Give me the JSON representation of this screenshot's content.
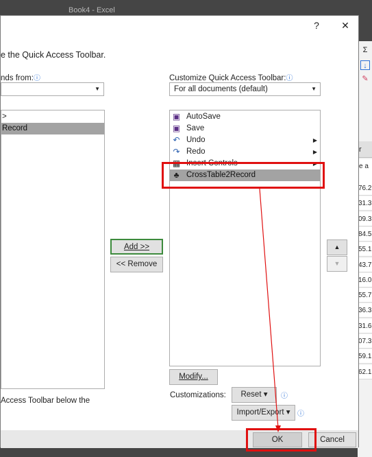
{
  "excel": {
    "window_title": "Book4 - Excel",
    "ribbon_icons": [
      "Σ",
      "↓",
      "✎"
    ],
    "column_header": "r",
    "header_cell": "e a",
    "cells": [
      "76.2",
      "31.3",
      "09.3",
      "84.5",
      "55.1",
      "43.7",
      "16.0",
      "55.7",
      "36.3",
      "31.6",
      "07.3",
      "59.1",
      "62.1"
    ]
  },
  "dialog": {
    "help_label": "?",
    "close_label": "✕",
    "intro_text": "e the Quick Access Toolbar.",
    "commands_from_label": "nds from:",
    "left_list": {
      "items": [
        {
          "label": ">"
        },
        {
          "label": "Record",
          "selected": true
        }
      ]
    },
    "customize_label": "Customize Quick Access Toolbar:",
    "customize_value": "For all documents (default)",
    "right_list": {
      "items": [
        {
          "label": "AutoSave",
          "icon": "save-icon",
          "glyph": "▣"
        },
        {
          "label": "Save",
          "icon": "save-icon",
          "glyph": "▣"
        },
        {
          "label": "Undo",
          "icon": "undo-icon",
          "glyph": "↶",
          "submenu": true
        },
        {
          "label": "Redo",
          "icon": "redo-icon",
          "glyph": "↷",
          "submenu": true
        },
        {
          "label": "Insert Controls",
          "icon": "table-icon",
          "glyph": "▦",
          "submenu": true
        },
        {
          "label": "CrossTable2Record",
          "icon": "flowchart-icon",
          "glyph": "♣",
          "selected": true
        }
      ]
    },
    "add_label": "Add >>",
    "remove_label": "<< Remove",
    "move_up_label": "▲",
    "move_down_label": "▼",
    "modify_label": "Modify...",
    "customizations_label": "Customizations:",
    "reset_label": "Reset ▾",
    "import_export_label": "Import/Export ▾",
    "bottom_left_text": "Access Toolbar below the",
    "ok_label": "OK",
    "cancel_label": "Cancel"
  },
  "annotation_color": "#e01010"
}
